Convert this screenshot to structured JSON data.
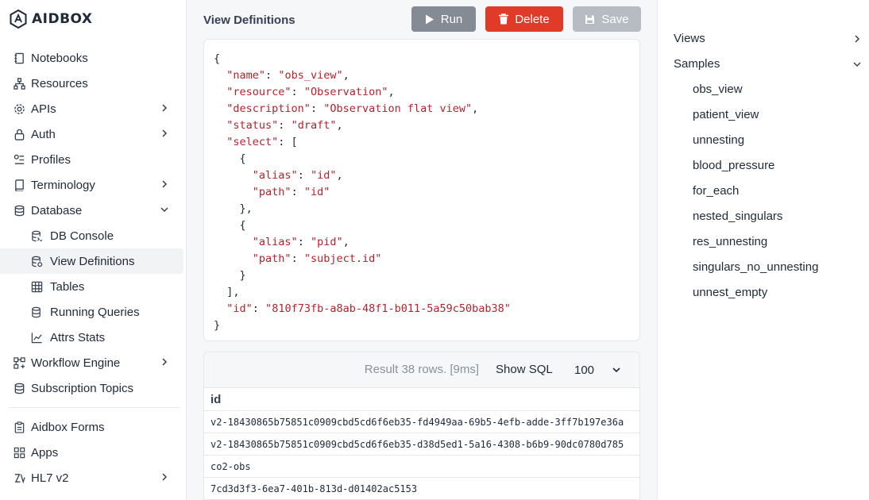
{
  "app": {
    "name": "AIDBOX"
  },
  "sidebar": {
    "items": [
      {
        "label": "Notebooks"
      },
      {
        "label": "Resources"
      },
      {
        "label": "APIs"
      },
      {
        "label": "Auth"
      },
      {
        "label": "Profiles"
      },
      {
        "label": "Terminology"
      },
      {
        "label": "Database"
      },
      {
        "label": "DB Console"
      },
      {
        "label": "View Definitions"
      },
      {
        "label": "Tables"
      },
      {
        "label": "Running Queries"
      },
      {
        "label": "Attrs Stats"
      },
      {
        "label": "Workflow Engine"
      },
      {
        "label": "Subscription Topics"
      }
    ],
    "bottom_items": [
      {
        "label": "Aidbox Forms"
      },
      {
        "label": "Apps"
      },
      {
        "label": "HL7 v2"
      }
    ]
  },
  "main": {
    "title": "View Definitions",
    "run_label": "Run",
    "delete_label": "Delete",
    "save_label": "Save",
    "code": {
      "name": "obs_view",
      "resource": "Observation",
      "description": "Observation flat view",
      "status": "draft",
      "select_aliases": [
        "id",
        "pid"
      ],
      "select_paths": [
        "id",
        "subject.id"
      ],
      "id": "810f73fb-a8ab-48f1-b011-5a59c50bab38"
    },
    "results": {
      "info": "Result 38 rows. [9ms]",
      "show_sql_label": "Show SQL",
      "limit": "100",
      "column": "id",
      "rows": [
        "v2-18430865b75851c0909cbd5cd6f6eb35-fd4949aa-69b5-4efb-adde-3ff7b197e36a",
        "v2-18430865b75851c0909cbd5cd6f6eb35-d38d5ed1-5a16-4308-b6b9-90dc0780d785",
        "co2-obs",
        "7cd3d3f3-6ea7-401b-813d-d01402ac5153"
      ]
    }
  },
  "right_panel": {
    "views_label": "Views",
    "samples_label": "Samples",
    "samples": [
      "obs_view",
      "patient_view",
      "unnesting",
      "blood_pressure",
      "for_each",
      "nested_singulars",
      "res_unnesting",
      "singulars_no_unnesting",
      "unnest_empty"
    ]
  },
  "colors": {
    "run_button": "#848b94",
    "delete_button": "#e03a28",
    "save_button": "#b7bcc2",
    "json_key_string": "#b3232e"
  }
}
